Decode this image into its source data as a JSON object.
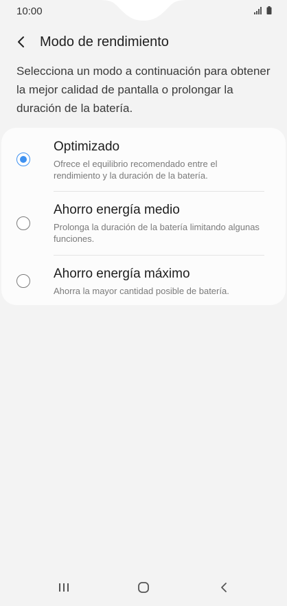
{
  "status_bar": {
    "time": "10:00",
    "icons": [
      "signal-icon",
      "battery-icon"
    ]
  },
  "header": {
    "title": "Modo de rendimiento",
    "back_icon": "back-arrow-icon"
  },
  "description": "Selecciona un modo a continuación para obtener la mejor calidad de pantalla o prolongar la duración de la batería.",
  "options": [
    {
      "title": "Optimizado",
      "description": "Ofrece el equilibrio recomendado entre el rendimiento y la duración de la batería.",
      "selected": true
    },
    {
      "title": "Ahorro energía medio",
      "description": "Prolonga la duración de la batería limitando algunas funciones.",
      "selected": false
    },
    {
      "title": "Ahorro energía máximo",
      "description": "Ahorra la mayor cantidad posible de batería.",
      "selected": false
    }
  ],
  "colors": {
    "accent": "#3e91f0",
    "background": "#f3f3f3",
    "card": "#fcfcfc"
  },
  "nav_bar": {
    "icons": [
      "recents-icon",
      "home-icon",
      "back-icon"
    ]
  }
}
